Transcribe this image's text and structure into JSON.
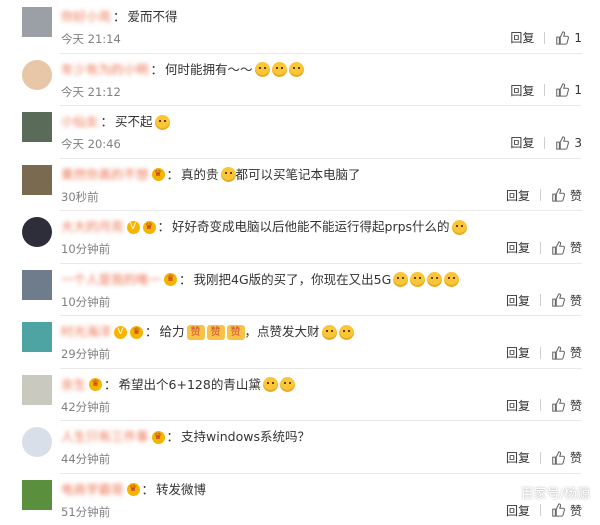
{
  "comments": [
    {
      "user": "你好小亮",
      "badges": [],
      "text": "爱而不得",
      "emojis": [],
      "time": "今天 21:14",
      "reply": "回复",
      "likes": "1",
      "avatar_color": "#9aa0a6"
    },
    {
      "user": "年少有为的小明",
      "badges": [],
      "text": "何时能拥有～～",
      "emojis": [
        "sad",
        "sad",
        "sad"
      ],
      "time": "今天 21:12",
      "reply": "回复",
      "likes": "1",
      "avatar_color": "#e8c7a8"
    },
    {
      "user": "小仙女",
      "badges": [],
      "text": "买不起",
      "emojis": [
        "cat"
      ],
      "time": "今天 20:46",
      "reply": "回复",
      "likes": "3",
      "avatar_color": "#5b6b5a"
    },
    {
      "user": "果然你真的不想",
      "badges": [
        "member"
      ],
      "text": "真的贵",
      "emojis": [
        "cry"
      ],
      "text2": "都可以买笔记本电脑了",
      "time": "30秒前",
      "reply": "回复",
      "likes": "赞",
      "avatar_color": "#7a6a4f"
    },
    {
      "user": "大大的月亮",
      "badges": [
        "v",
        "member"
      ],
      "text": "好好奇变成电脑以后他能不能运行得起prps什么的",
      "emojis": [
        "cat"
      ],
      "time": "10分钟前",
      "reply": "回复",
      "likes": "赞",
      "avatar_color": "#2e2e3a"
    },
    {
      "user": "一个人是我的唯一",
      "badges": [
        "member"
      ],
      "text": "我刚把4G版的买了，你现在又出5G",
      "emojis": [
        "smile",
        "smile",
        "smile",
        "smile"
      ],
      "time": "10分钟前",
      "reply": "回复",
      "likes": "赞",
      "avatar_color": "#6f7c8c"
    },
    {
      "user": "时光海洋",
      "badges": [
        "v",
        "member"
      ],
      "text": "给力",
      "emojis": [
        "zan",
        "zan",
        "zan"
      ],
      "text2": "，点赞发大财",
      "emojis2": [
        "laugh",
        "hand"
      ],
      "time": "29分钟前",
      "reply": "回复",
      "likes": "赞",
      "avatar_color": "#4ea3a3"
    },
    {
      "user": "余生",
      "badges": [
        "member"
      ],
      "text": "希望出个6+128的青山黛",
      "emojis": [
        "laugh",
        "laugh"
      ],
      "time": "42分钟前",
      "reply": "回复",
      "likes": "赞",
      "avatar_color": "#c9c9c0"
    },
    {
      "user": "人生只有三件事",
      "badges": [
        "member"
      ],
      "text": "支持windows系统吗？",
      "emojis": [],
      "time": "44分钟前",
      "reply": "回复",
      "likes": "赞",
      "avatar_color": "#d8dfe8"
    },
    {
      "user": "电商学霸哥",
      "badges": [
        "member"
      ],
      "text": "转发微博",
      "emojis": [],
      "time": "51分钟前",
      "reply": "回复",
      "likes": "赞",
      "avatar_color": "#5a8f3e"
    }
  ],
  "watermark": "百家号/杨源",
  "colors": {
    "username": "#eb7350",
    "time": "#808080",
    "text": "#333333"
  }
}
